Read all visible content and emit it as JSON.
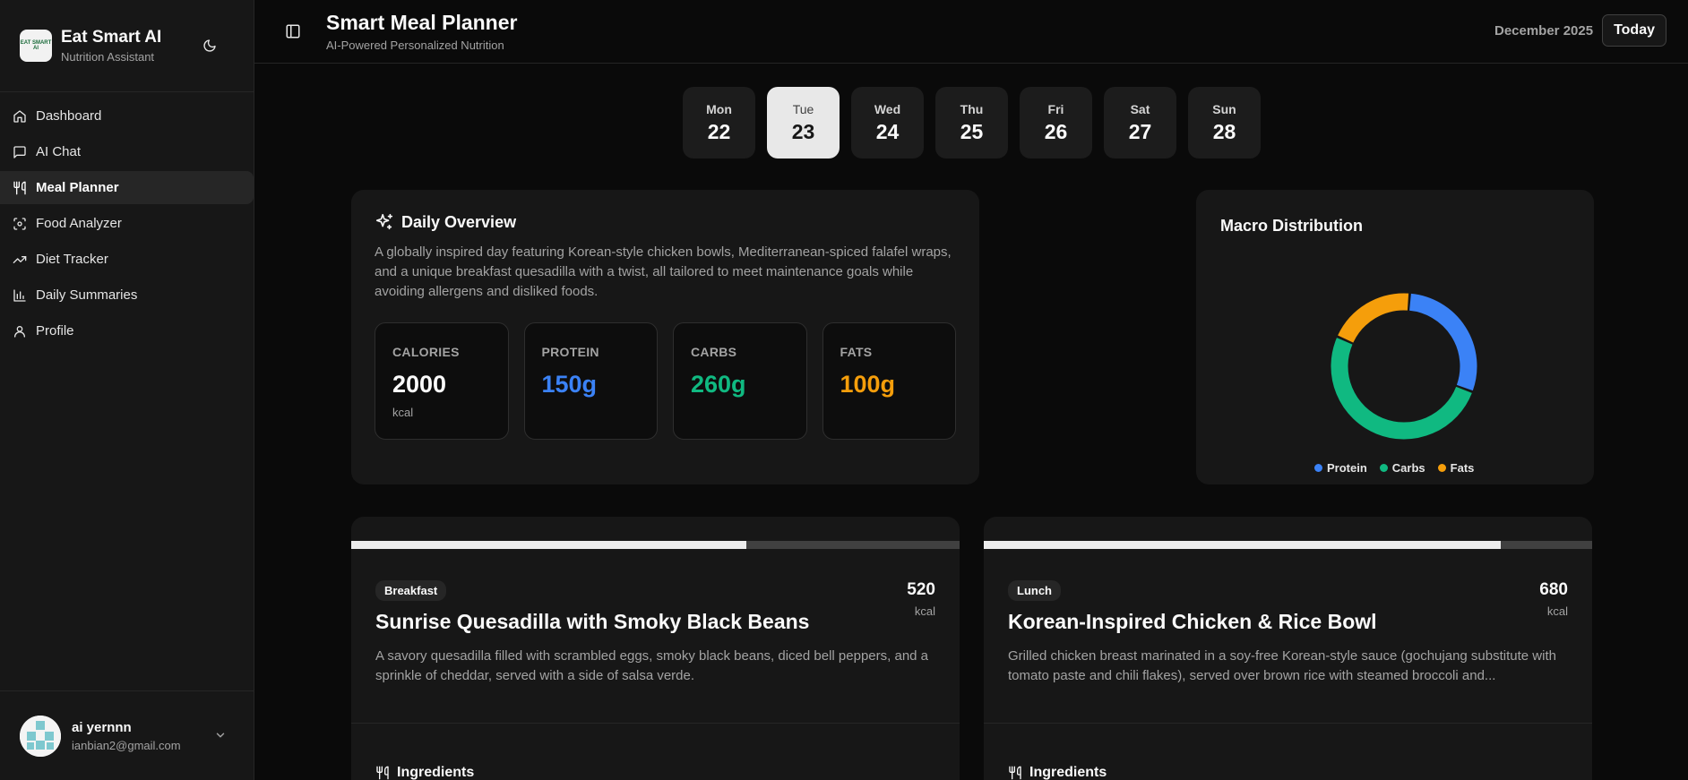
{
  "app": {
    "name": "Eat Smart AI",
    "tagline": "Nutrition Assistant",
    "logo_text": "EAT SMART AI"
  },
  "sidebar": {
    "items": [
      {
        "label": "Dashboard",
        "icon": "home-icon"
      },
      {
        "label": "AI Chat",
        "icon": "chat-icon"
      },
      {
        "label": "Meal Planner",
        "icon": "utensils-icon",
        "active": true
      },
      {
        "label": "Food Analyzer",
        "icon": "scan-icon"
      },
      {
        "label": "Diet Tracker",
        "icon": "trending-up-icon"
      },
      {
        "label": "Daily Summaries",
        "icon": "bar-chart-icon"
      },
      {
        "label": "Profile",
        "icon": "user-icon"
      }
    ]
  },
  "user": {
    "name": "ai yernnn",
    "email": "ianbian2@gmail.com"
  },
  "header": {
    "title": "Smart Meal Planner",
    "subtitle": "AI-Powered Personalized Nutrition",
    "month": "December 2025",
    "today_label": "Today"
  },
  "days": [
    {
      "name": "Mon",
      "num": "22"
    },
    {
      "name": "Tue",
      "num": "23",
      "active": true
    },
    {
      "name": "Wed",
      "num": "24"
    },
    {
      "name": "Thu",
      "num": "25"
    },
    {
      "name": "Fri",
      "num": "26"
    },
    {
      "name": "Sat",
      "num": "27"
    },
    {
      "name": "Sun",
      "num": "28"
    }
  ],
  "overview": {
    "title": "Daily Overview",
    "description": "A globally inspired day featuring Korean-style chicken bowls, Mediterranean-spiced falafel wraps, and a unique breakfast quesadilla with a twist, all tailored to meet maintenance goals while avoiding allergens and disliked foods.",
    "stats": [
      {
        "label": "CALORIES",
        "value": "2000",
        "unit": "kcal",
        "color": "#fafafa"
      },
      {
        "label": "PROTEIN",
        "value": "150g",
        "color": "#3b82f6"
      },
      {
        "label": "CARBS",
        "value": "260g",
        "color": "#10b981"
      },
      {
        "label": "FATS",
        "value": "100g",
        "color": "#f59e0b"
      }
    ]
  },
  "macro": {
    "title": "Macro Distribution",
    "legend": [
      {
        "name": "Protein",
        "color": "#3b82f6"
      },
      {
        "name": "Carbs",
        "color": "#10b981"
      },
      {
        "name": "Fats",
        "color": "#f59e0b"
      }
    ]
  },
  "chart_data": {
    "type": "pie",
    "title": "Macro Distribution",
    "categories": [
      "Protein",
      "Carbs",
      "Fats"
    ],
    "values": [
      150,
      260,
      100
    ],
    "colors": [
      "#3b82f6",
      "#10b981",
      "#f59e0b"
    ],
    "donut": true,
    "legend": "bottom"
  },
  "meals": [
    {
      "type": "Breakfast",
      "kcal": "520",
      "kcal_unit": "kcal",
      "title": "Sunrise Quesadilla with Smoky Black Beans",
      "description": "A savory quesadilla filled with scrambled eggs, smoky black beans, diced bell peppers, and a sprinkle of cheddar, served with a side of salsa verde.",
      "progress": 0.65,
      "ingredients_label": "Ingredients"
    },
    {
      "type": "Lunch",
      "kcal": "680",
      "kcal_unit": "kcal",
      "title": "Korean-Inspired Chicken & Rice Bowl",
      "description": "Grilled chicken breast marinated in a soy-free Korean-style sauce (gochujang substitute with tomato paste and chili flakes), served over brown rice with steamed broccoli and...",
      "progress": 0.85,
      "ingredients_label": "Ingredients"
    }
  ]
}
